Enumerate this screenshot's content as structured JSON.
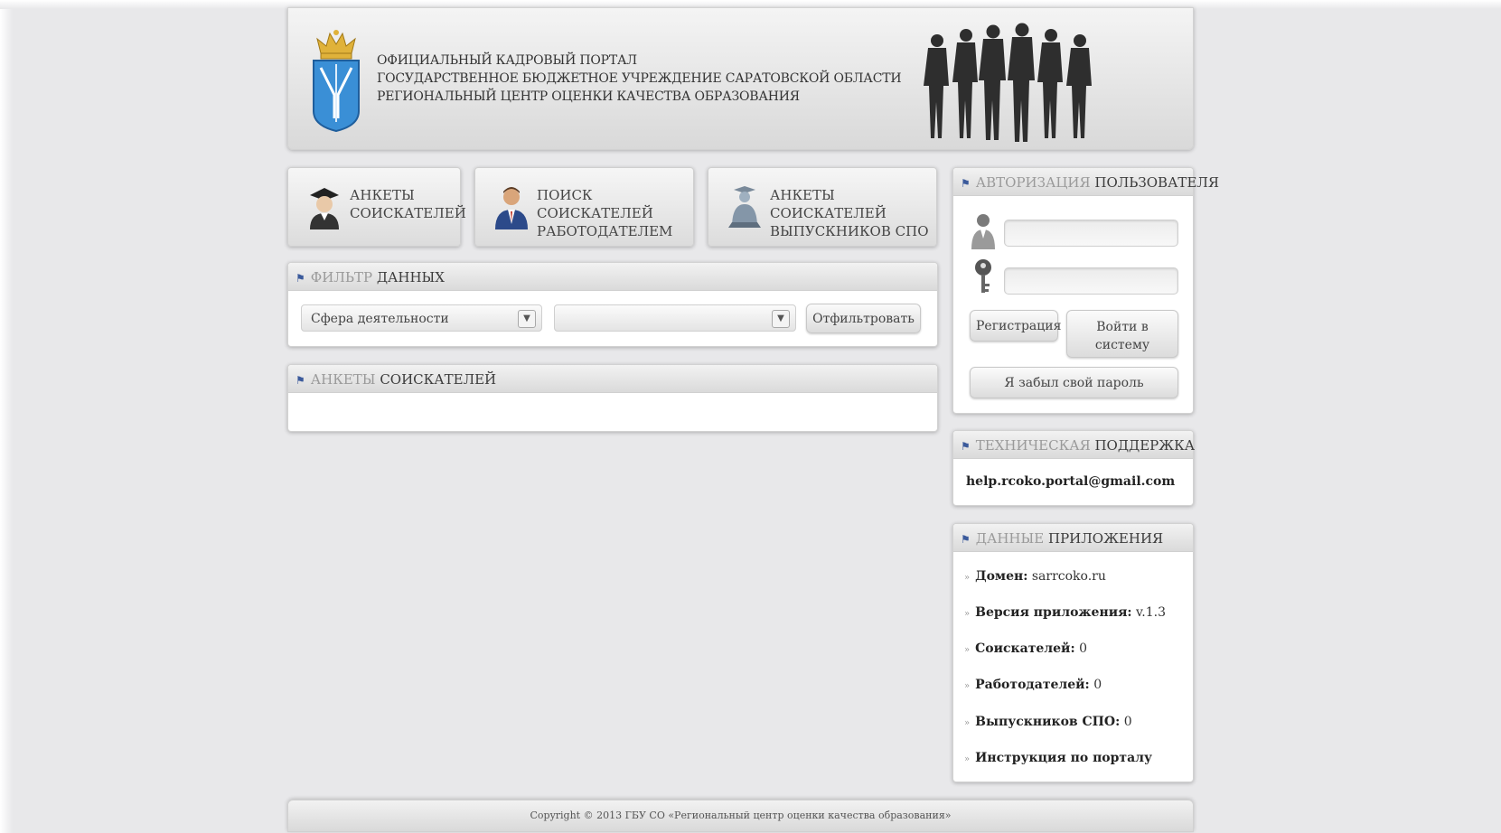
{
  "header": {
    "line1": "ОФИЦИАЛЬНЫЙ КАДРОВЫЙ ПОРТАЛ",
    "line2": "ГОСУДАРСТВЕННОЕ БЮДЖЕТНОЕ УЧРЕЖДЕНИЕ САРАТОВСКОЙ ОБЛАСТИ",
    "line3": "РЕГИОНАЛЬНЫЙ ЦЕНТР ОЦЕНКИ КАЧЕСТВА ОБРАЗОВАНИЯ"
  },
  "nav": {
    "applicants_line1": "АНКЕТЫ",
    "applicants_line2": "СОИСКАТЕЛЕЙ",
    "search_line1": "ПОИСК СОИСКАТЕЛЕЙ",
    "search_line2": "РАБОТОДАТЕЛЕМ",
    "graduates_line1": "АНКЕТЫ СОИСКАТЕЛЕЙ",
    "graduates_line2": "ВЫПУСКНИКОВ СПО"
  },
  "filter": {
    "title_light": "ФИЛЬТР",
    "title_dark": "ДАННЫХ",
    "select1_value": "Сфера деятельности",
    "select2_value": "",
    "button_label": "Отфильтровать"
  },
  "applicants_panel": {
    "title_light": "АНКЕТЫ",
    "title_dark": "СОИСКАТЕЛЕЙ"
  },
  "auth": {
    "title_light": "АВТОРИЗАЦИЯ",
    "title_dark": "ПОЛЬЗОВАТЕЛЯ",
    "login_value": "",
    "password_value": "",
    "register_label": "Регистрация",
    "login_label_line1": "Войти в",
    "login_label_line2": "систему",
    "forgot_label": "Я забыл свой пароль"
  },
  "support": {
    "title_light": "ТЕХНИЧЕСКАЯ",
    "title_dark": "ПОДДЕРЖКА",
    "email": "help.rcoko.portal@gmail.com"
  },
  "app_info": {
    "title_light": "ДАННЫЕ",
    "title_dark": "ПРИЛОЖЕНИЯ",
    "domain_label": "Домен:",
    "domain_value": "sarrcoko.ru",
    "version_label": "Версия приложения:",
    "version_value": "v.1.3",
    "applicants_label": "Соискателей:",
    "applicants_value": "0",
    "employers_label": "Работодателей:",
    "employers_value": "0",
    "graduates_label": "Выпускников СПО:",
    "graduates_value": "0",
    "manual_label": "Инструкция по порталу"
  },
  "footer": {
    "copyright": "Copyright © 2013 ГБУ СО «Региональный центр оценки качества образования»"
  },
  "colors": {
    "background": "#e8e8ea",
    "panel_header_light_text": "#9a9a9a",
    "panel_header_dark_text": "#3c3c3c",
    "pin_icon": "#3b5a9b",
    "crest_blue": "#3a8fd6",
    "crown_gold": "#e0b23a"
  }
}
